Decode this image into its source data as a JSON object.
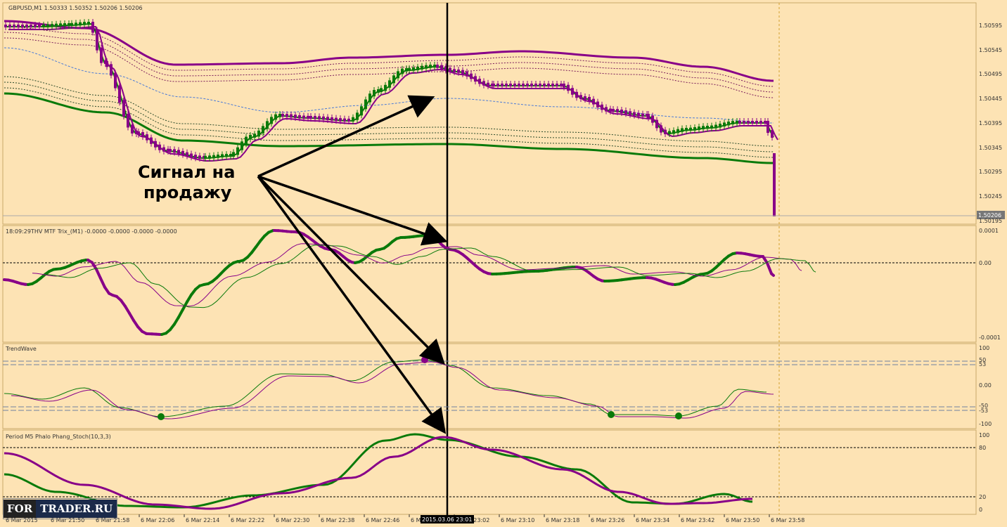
{
  "symbol_header": "GBPUSD,M1 1.50333 1.50352 1.50206 1.50206",
  "price_axis": [
    "1.50595",
    "1.50545",
    "1.50495",
    "1.50445",
    "1.50395",
    "1.50345",
    "1.50295",
    "1.50245",
    "1.50195"
  ],
  "current_price": "1.50206",
  "signal_text": [
    "Сигнал на",
    "продажу"
  ],
  "trix": {
    "title": "18:09:29THV MTF Trix_(M1) -0.0000 -0.0000 -0.0000 -0.0000",
    "axis": [
      "0.0001",
      "0.00",
      "-0.0001"
    ]
  },
  "trendwave": {
    "title": "TrendWave",
    "axis": [
      "100",
      "50",
      "53",
      "0.00",
      "-50",
      "-53",
      "-100"
    ]
  },
  "stoch": {
    "title": "Period M5 Phalo Phang_Stoch(10,3,3)",
    "axis": [
      "100",
      "80",
      "20",
      "0"
    ]
  },
  "time_axis": [
    "6 Mar 2015",
    "6 Mar 21:50",
    "6 Mar 21:58",
    "6 Mar 22:06",
    "6 Mar 22:14",
    "6 Mar 22:22",
    "6 Mar 22:30",
    "6 Mar 22:38",
    "6 Mar 22:46",
    "6 Mar 22:54",
    "6 Mar 23:02",
    "6 Mar 23:10",
    "6 Mar 23:18",
    "6 Mar 23:26",
    "6 Mar 23:34",
    "6 Mar 23:42",
    "6 Mar 23:50",
    "6 Mar 23:58"
  ],
  "cursor_time": "2015.03.06 23:01",
  "logo": {
    "left": "FOR",
    "right": "TRADER.RU"
  },
  "colors": {
    "bg": "#fde3b4",
    "bull": "#0a7a0a",
    "bear": "#880088",
    "grid": "#c8a66a"
  }
}
